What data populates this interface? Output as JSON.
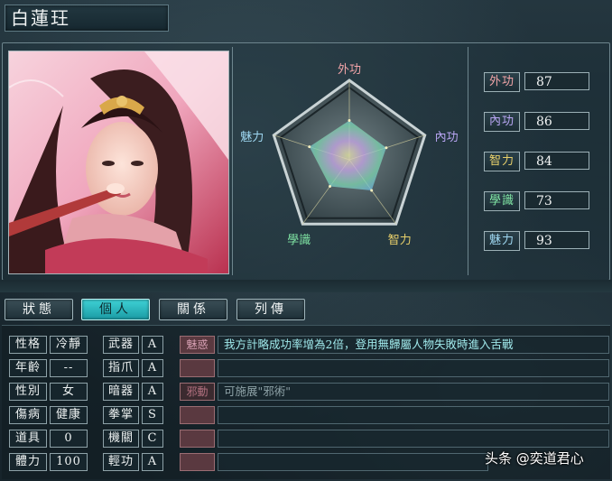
{
  "character": {
    "name": "白蓮玨"
  },
  "radar": {
    "labels": [
      "外功",
      "內功",
      "智力",
      "學識",
      "魅力"
    ],
    "label_colors": [
      "#f2a4a8",
      "#b9a6f4",
      "#e7cf6a",
      "#7fe3a3",
      "#9fd8f2"
    ],
    "scale_max": 100
  },
  "stats": [
    {
      "label": "外功",
      "value": "87",
      "color": "#f2a4a8"
    },
    {
      "label": "內功",
      "value": "86",
      "color": "#b9a6f4"
    },
    {
      "label": "智力",
      "value": "84",
      "color": "#e7cf6a"
    },
    {
      "label": "學識",
      "value": "73",
      "color": "#7fe3a3"
    },
    {
      "label": "魅力",
      "value": "93",
      "color": "#9fd8f2"
    }
  ],
  "tabs": [
    {
      "label": "狀態",
      "active": false
    },
    {
      "label": "個人",
      "active": true
    },
    {
      "label": "關係",
      "active": false
    },
    {
      "label": "列傳",
      "active": false
    }
  ],
  "personal": [
    {
      "label": "性格",
      "value": "冷靜"
    },
    {
      "label": "年齡",
      "value": "--"
    },
    {
      "label": "性別",
      "value": "女"
    },
    {
      "label": "傷病",
      "value": "健康"
    },
    {
      "label": "道具",
      "value": "0"
    },
    {
      "label": "體力",
      "value": "100"
    }
  ],
  "weapons": [
    {
      "label": "武器",
      "grade": "A"
    },
    {
      "label": "指爪",
      "grade": "A"
    },
    {
      "label": "暗器",
      "grade": "A"
    },
    {
      "label": "拳掌",
      "grade": "S"
    },
    {
      "label": "機關",
      "grade": "C"
    },
    {
      "label": "輕功",
      "grade": "A"
    }
  ],
  "skills": [
    {
      "name": "魅惑",
      "desc": "我方計略成功率增為2倍，登用無歸屬人物失敗時進入舌戰",
      "active": true
    },
    {
      "name": "",
      "desc": "",
      "active": false
    },
    {
      "name": "邪動",
      "desc": "可施展\"邪術\"",
      "active": false
    },
    {
      "name": "",
      "desc": "",
      "active": false
    },
    {
      "name": "",
      "desc": "",
      "active": false
    },
    {
      "name": "",
      "desc": "",
      "active": false
    }
  ],
  "watermark": "头条 @奕道君心"
}
